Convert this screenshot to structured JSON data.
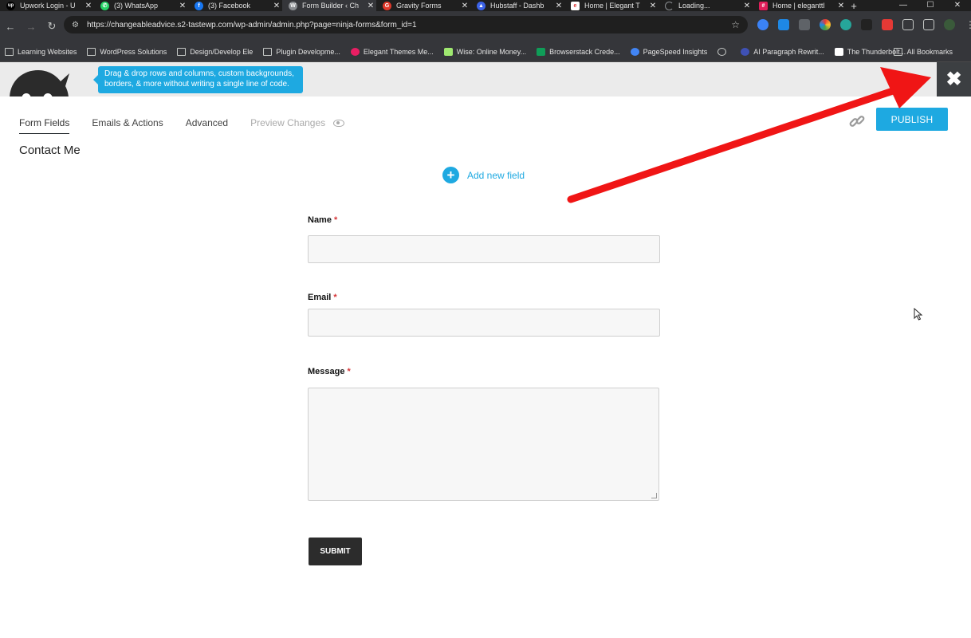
{
  "browser": {
    "tabs": [
      {
        "title": "Upwork Login - U",
        "favicon": "upwork-icon",
        "color": "#000000"
      },
      {
        "title": "(3) WhatsApp",
        "favicon": "whatsapp-icon",
        "color": "#25d366"
      },
      {
        "title": "(3) Facebook",
        "favicon": "facebook-icon",
        "color": "#1877f2"
      },
      {
        "title": "Form Builder ‹ Ch",
        "favicon": "wordpress-icon",
        "color": "#8a8d91",
        "active": true
      },
      {
        "title": "Gravity Forms",
        "favicon": "gravity-forms-icon",
        "color": "#e0392b"
      },
      {
        "title": "Hubstaff - Dashb",
        "favicon": "hubstaff-icon",
        "color": "#3c63e7"
      },
      {
        "title": "Home | Elegant T",
        "favicon": "elegant-themes-icon",
        "color": "#ffffff"
      },
      {
        "title": "Loading...",
        "favicon": "loading-spinner-icon",
        "color": "#8a8d91"
      },
      {
        "title": "Home | eleganttl",
        "favicon": "slack-icon",
        "color": "#e01e5a"
      }
    ],
    "new_tab_label": "+",
    "address_bar": {
      "url": "https://changeableadvice.s2-tastewp.com/wp-admin/admin.php?page=ninja-forms&form_id=1"
    },
    "bookmarks": [
      {
        "label": "Learning Websites",
        "icon": "folder-icon"
      },
      {
        "label": "WordPress Solutions",
        "icon": "folder-icon"
      },
      {
        "label": "Design/Develop Ele",
        "icon": "folder-icon"
      },
      {
        "label": "Plugin Developme...",
        "icon": "folder-icon"
      },
      {
        "label": "Elegant Themes Me...",
        "icon": "elegant-themes-icon"
      },
      {
        "label": "Wise: Online Money...",
        "icon": "wise-icon"
      },
      {
        "label": "Browserstack Crede...",
        "icon": "sheets-icon"
      },
      {
        "label": "PageSpeed Insights",
        "icon": "pagespeed-icon"
      },
      {
        "label": "",
        "icon": "globe-icon"
      },
      {
        "label": "AI Paragraph Rewrit...",
        "icon": "ai-icon"
      },
      {
        "label": "The Thunderbolt...",
        "icon": "thunderbolt-icon"
      }
    ],
    "all_bookmarks_label": "All Bookmarks"
  },
  "header": {
    "tooltip_line1": "Drag & drop rows and columns, custom backgrounds,",
    "tooltip_line2": "borders, & more without writing a single line of code."
  },
  "subnav": {
    "form_fields": "Form Fields",
    "emails_actions": "Emails & Actions",
    "advanced": "Advanced",
    "preview_changes": "Preview Changes"
  },
  "publish_label": "PUBLISH",
  "form_title": "Contact Me",
  "add_field_label": "Add new field",
  "fields": {
    "name_label": "Name",
    "email_label": "Email",
    "message_label": "Message",
    "required_mark": "*"
  },
  "submit_label": "SUBMIT",
  "colors": {
    "accent": "#1ea9e1",
    "required": "#d63638",
    "annotation_arrow": "#f01515"
  }
}
